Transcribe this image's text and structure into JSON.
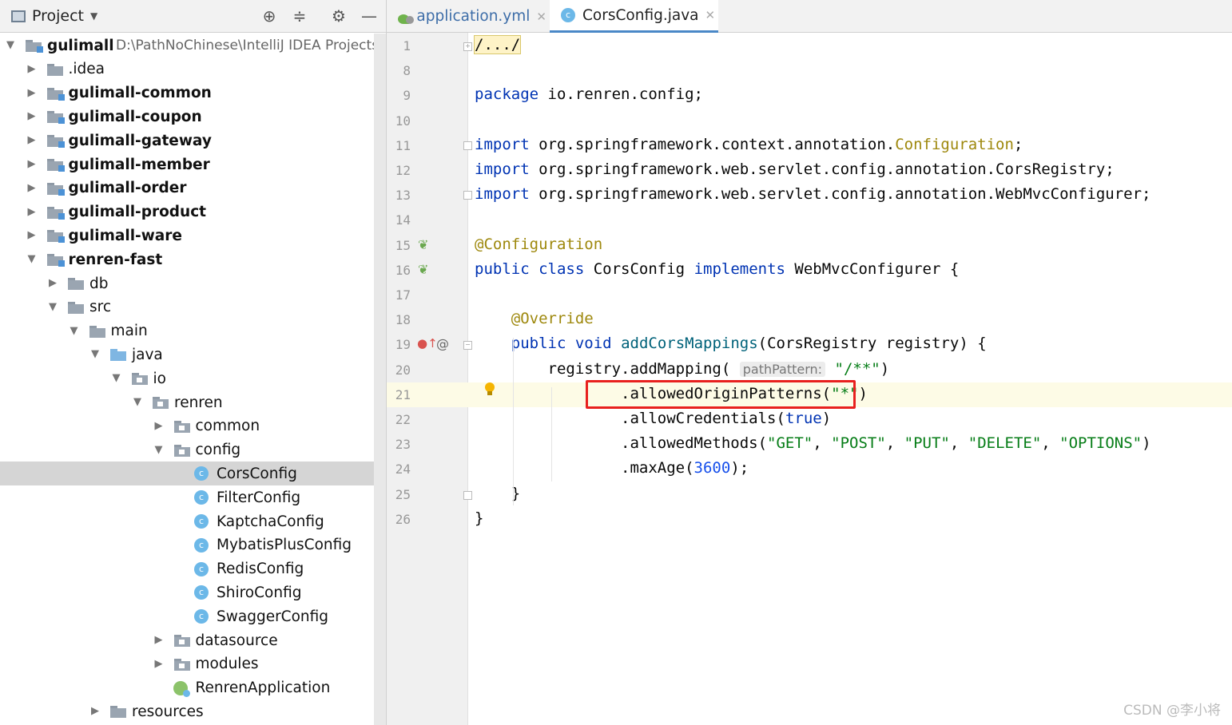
{
  "project_panel": {
    "title": "Project",
    "tree": [
      {
        "label": "gulimall",
        "path": "D:\\PathNoChinese\\IntelliJ IDEA Projects",
        "depth": 0,
        "expanded": true,
        "icon": "module-folder-icon",
        "bold": true
      },
      {
        "label": ".idea",
        "depth": 1,
        "expanded": false,
        "icon": "folder-icon"
      },
      {
        "label": "gulimall-common",
        "depth": 1,
        "expanded": false,
        "icon": "module-folder-icon",
        "bold": true
      },
      {
        "label": "gulimall-coupon",
        "depth": 1,
        "expanded": false,
        "icon": "module-folder-icon",
        "bold": true
      },
      {
        "label": "gulimall-gateway",
        "depth": 1,
        "expanded": false,
        "icon": "module-folder-icon",
        "bold": true
      },
      {
        "label": "gulimall-member",
        "depth": 1,
        "expanded": false,
        "icon": "module-folder-icon",
        "bold": true
      },
      {
        "label": "gulimall-order",
        "depth": 1,
        "expanded": false,
        "icon": "module-folder-icon",
        "bold": true
      },
      {
        "label": "gulimall-product",
        "depth": 1,
        "expanded": false,
        "icon": "module-folder-icon",
        "bold": true
      },
      {
        "label": "gulimall-ware",
        "depth": 1,
        "expanded": false,
        "icon": "module-folder-icon",
        "bold": true
      },
      {
        "label": "renren-fast",
        "depth": 1,
        "expanded": true,
        "icon": "module-folder-icon",
        "bold": true
      },
      {
        "label": "db",
        "depth": 2,
        "expanded": false,
        "icon": "folder-icon"
      },
      {
        "label": "src",
        "depth": 2,
        "expanded": true,
        "icon": "folder-icon"
      },
      {
        "label": "main",
        "depth": 3,
        "expanded": true,
        "icon": "folder-icon"
      },
      {
        "label": "java",
        "depth": 4,
        "expanded": true,
        "icon": "source-folder-icon"
      },
      {
        "label": "io",
        "depth": 5,
        "expanded": true,
        "icon": "package-icon"
      },
      {
        "label": "renren",
        "depth": 6,
        "expanded": true,
        "icon": "package-icon"
      },
      {
        "label": "common",
        "depth": 7,
        "expanded": false,
        "icon": "package-icon"
      },
      {
        "label": "config",
        "depth": 7,
        "expanded": true,
        "icon": "package-icon"
      },
      {
        "label": "CorsConfig",
        "depth": 8,
        "icon": "class-icon",
        "selected": true
      },
      {
        "label": "FilterConfig",
        "depth": 8,
        "icon": "class-icon"
      },
      {
        "label": "KaptchaConfig",
        "depth": 8,
        "icon": "class-icon"
      },
      {
        "label": "MybatisPlusConfig",
        "depth": 8,
        "icon": "class-icon"
      },
      {
        "label": "RedisConfig",
        "depth": 8,
        "icon": "class-icon"
      },
      {
        "label": "ShiroConfig",
        "depth": 8,
        "icon": "class-icon"
      },
      {
        "label": "SwaggerConfig",
        "depth": 8,
        "icon": "class-icon"
      },
      {
        "label": "datasource",
        "depth": 7,
        "expanded": false,
        "icon": "package-icon"
      },
      {
        "label": "modules",
        "depth": 7,
        "expanded": false,
        "icon": "package-icon"
      },
      {
        "label": "RenrenApplication",
        "depth": 7,
        "icon": "spring-boot-app-icon"
      },
      {
        "label": "resources",
        "depth": 4,
        "expanded": false,
        "icon": "resources-folder-icon"
      }
    ]
  },
  "editor": {
    "tabs": [
      {
        "label": "application.yml",
        "icon": "yaml-icon",
        "active": false
      },
      {
        "label": "CorsConfig.java",
        "icon": "class-icon",
        "active": true
      }
    ],
    "lines": [
      {
        "num": "1",
        "tokens": [
          {
            "t": "/.../",
            "c": "fold-hl"
          }
        ]
      },
      {
        "num": "8",
        "tokens": []
      },
      {
        "num": "9",
        "tokens": [
          {
            "t": "package",
            "c": "kw"
          },
          {
            "t": " io.renren.config;"
          }
        ]
      },
      {
        "num": "10",
        "tokens": []
      },
      {
        "num": "11",
        "tokens": [
          {
            "t": "import",
            "c": "kw"
          },
          {
            "t": " org.springframework.context.annotation."
          },
          {
            "t": "Configuration",
            "c": "cls"
          },
          {
            "t": ";"
          }
        ]
      },
      {
        "num": "12",
        "tokens": [
          {
            "t": "import",
            "c": "kw"
          },
          {
            "t": " org.springframework.web.servlet.config.annotation.CorsRegistry;"
          }
        ]
      },
      {
        "num": "13",
        "tokens": [
          {
            "t": "import",
            "c": "kw"
          },
          {
            "t": " org.springframework.web.servlet.config.annotation.WebMvcConfigurer;"
          }
        ]
      },
      {
        "num": "14",
        "tokens": []
      },
      {
        "num": "15",
        "tokens": [
          {
            "t": "@Configuration",
            "c": "ann"
          }
        ]
      },
      {
        "num": "16",
        "tokens": [
          {
            "t": "public class",
            "c": "kw"
          },
          {
            "t": " CorsConfig "
          },
          {
            "t": "implements",
            "c": "kw"
          },
          {
            "t": " WebMvcConfigurer {"
          }
        ]
      },
      {
        "num": "17",
        "tokens": []
      },
      {
        "num": "18",
        "tokens": [
          {
            "t": "    "
          },
          {
            "t": "@Override",
            "c": "ann"
          }
        ]
      },
      {
        "num": "19",
        "tokens": [
          {
            "t": "    "
          },
          {
            "t": "public void",
            "c": "kw"
          },
          {
            "t": " "
          },
          {
            "t": "addCorsMappings",
            "c": "mth"
          },
          {
            "t": "(CorsRegistry registry) {"
          }
        ]
      },
      {
        "num": "20",
        "tokens": [
          {
            "t": "        registry.addMapping( "
          },
          {
            "t": "pathPattern:",
            "c": "hint"
          },
          {
            "t": " "
          },
          {
            "t": "\"/**\"",
            "c": "str"
          },
          {
            "t": ")"
          }
        ]
      },
      {
        "num": "21",
        "tokens": [
          {
            "t": "                .allowedOriginPatterns("
          },
          {
            "t": "\"*\"",
            "c": "str"
          },
          {
            "t": ")"
          }
        ],
        "current": true
      },
      {
        "num": "22",
        "tokens": [
          {
            "t": "                .allowCredentials("
          },
          {
            "t": "true",
            "c": "kw"
          },
          {
            "t": ")"
          }
        ]
      },
      {
        "num": "23",
        "tokens": [
          {
            "t": "                .allowedMethods("
          },
          {
            "t": "\"GET\"",
            "c": "str"
          },
          {
            "t": ", "
          },
          {
            "t": "\"POST\"",
            "c": "str"
          },
          {
            "t": ", "
          },
          {
            "t": "\"PUT\"",
            "c": "str"
          },
          {
            "t": ", "
          },
          {
            "t": "\"DELETE\"",
            "c": "str"
          },
          {
            "t": ", "
          },
          {
            "t": "\"OPTIONS\"",
            "c": "str"
          },
          {
            "t": ")"
          }
        ]
      },
      {
        "num": "24",
        "tokens": [
          {
            "t": "                .maxAge("
          },
          {
            "t": "3600",
            "c": "num"
          },
          {
            "t": ");"
          }
        ]
      },
      {
        "num": "25",
        "tokens": [
          {
            "t": "    }"
          }
        ]
      },
      {
        "num": "26",
        "tokens": [
          {
            "t": "}"
          }
        ]
      }
    ],
    "highlight_color": "#e8201e"
  },
  "watermark": "CSDN @李小将",
  "colors": {
    "keyword": "#0033b3",
    "annotation": "#9e880d",
    "string": "#067d17",
    "number": "#1750eb",
    "selection": "#d5d5d5"
  }
}
